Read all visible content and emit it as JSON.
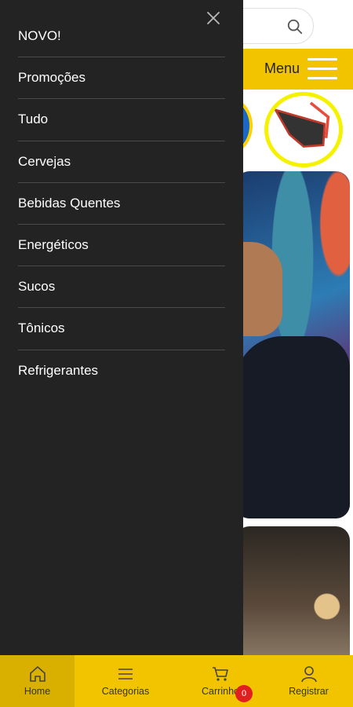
{
  "header": {
    "menu_label": "Menu"
  },
  "drawer": {
    "items": [
      {
        "label": "NOVO!"
      },
      {
        "label": "Promoções"
      },
      {
        "label": "Tudo"
      },
      {
        "label": "Cervejas"
      },
      {
        "label": "Bebidas Quentes"
      },
      {
        "label": "Energéticos"
      },
      {
        "label": "Sucos"
      },
      {
        "label": "Tônicos"
      },
      {
        "label": "Refrigerantes"
      }
    ]
  },
  "bottom_nav": {
    "home": "Home",
    "categories": "Categorias",
    "cart": "Carrinho",
    "cart_count": "0",
    "register": "Registrar"
  },
  "colors": {
    "accent": "#f2c400",
    "drawer_bg": "#232323",
    "badge": "#e02020"
  }
}
